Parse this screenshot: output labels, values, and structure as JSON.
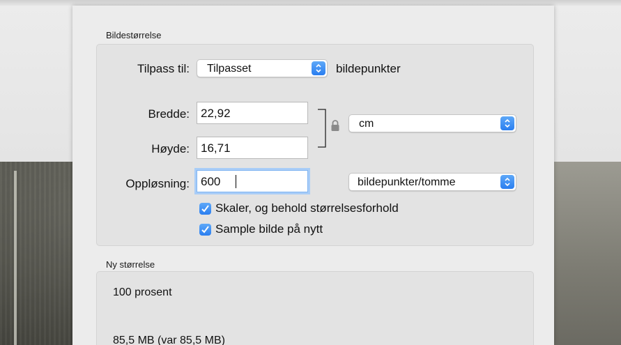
{
  "image_size": {
    "title": "Bildestørrelse",
    "fit_to": {
      "label": "Tilpass til:",
      "value": "Tilpasset",
      "suffix": "bildepunkter"
    },
    "width": {
      "label": "Bredde:",
      "value": "22,92"
    },
    "height": {
      "label": "Høyde:",
      "value": "16,71"
    },
    "unit": {
      "value": "cm"
    },
    "resolution": {
      "label": "Oppløsning:",
      "value": "600",
      "unit": "bildepunkter/tomme"
    },
    "scale_proportionally": {
      "label": "Skaler, og behold størrelsesforhold",
      "checked": true
    },
    "resample": {
      "label": "Sample bilde på nytt",
      "checked": true
    }
  },
  "new_size": {
    "title": "Ny størrelse",
    "percent": "100 prosent",
    "filesize": "85,5 MB (var 85,5 MB)"
  },
  "colors": {
    "accent": "#2a7ef0",
    "focus_ring": "#a9cdf7"
  },
  "icons": {
    "lock": "lock-icon",
    "popup_arrows": "chevron-updown-icon",
    "check": "checkmark-icon"
  }
}
